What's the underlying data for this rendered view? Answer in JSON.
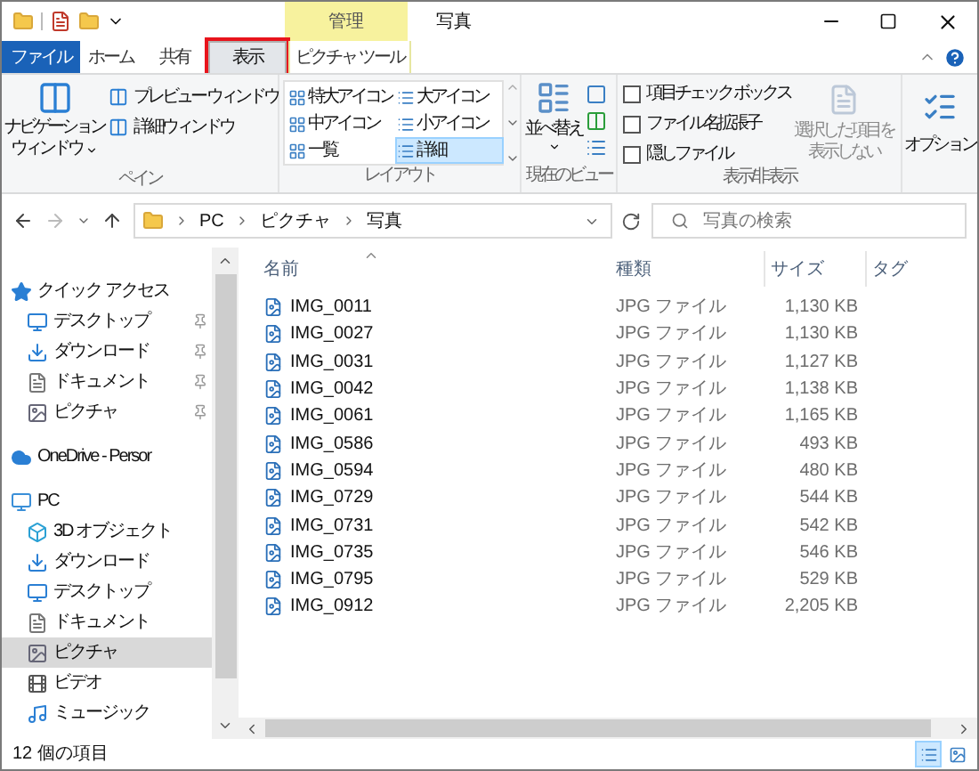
{
  "title_bar": {
    "title": "写真",
    "context_group": "管理"
  },
  "ribbon_tabs": [
    {
      "label": "ファイル",
      "kind": "file",
      "selected": false,
      "highlighted": false
    },
    {
      "label": "ホーム",
      "kind": "tab",
      "selected": false,
      "highlighted": false
    },
    {
      "label": "共有",
      "kind": "tab",
      "selected": false,
      "highlighted": false
    },
    {
      "label": "表示",
      "kind": "tab",
      "selected": true,
      "highlighted": true
    },
    {
      "label": "ピクチャ ツール",
      "kind": "context",
      "selected": false,
      "highlighted": false
    }
  ],
  "ribbon": {
    "pane": {
      "title": "ペイン",
      "nav_button": [
        "ナビゲーション",
        "ウィンドウ"
      ],
      "buttons": [
        "プレビュー ウィンドウ",
        "詳細ウィンドウ"
      ]
    },
    "layout": {
      "title": "レイアウト",
      "options": [
        {
          "label": "特大アイコン",
          "selected": false
        },
        {
          "label": "大アイコン",
          "selected": false
        },
        {
          "label": "中アイコン",
          "selected": false
        },
        {
          "label": "小アイコン",
          "selected": false
        },
        {
          "label": "一覧",
          "selected": false
        },
        {
          "label": "詳細",
          "selected": true
        }
      ]
    },
    "current_view": {
      "title": "現在のビュー",
      "sort_button": "並べ替え"
    },
    "show_hide": {
      "title": "表示/非表示",
      "checkboxes": [
        {
          "label": "項目チェック ボックス",
          "checked": false
        },
        {
          "label": "ファイル名拡張子",
          "checked": false
        },
        {
          "label": "隠しファイル",
          "checked": false
        }
      ],
      "hide_selected": {
        "lines": [
          "選択した項目を",
          "表示しない"
        ],
        "disabled": true
      }
    },
    "options": {
      "label": "オプション"
    }
  },
  "address_bar": {
    "path": [
      "PC",
      "ピクチャ",
      "写真"
    ],
    "search_placeholder": "写真の検索"
  },
  "navigation": [
    {
      "label": "クイック アクセス",
      "kind": "star",
      "selected": false,
      "children": [
        {
          "label": "デスクトップ",
          "kind": "desktop",
          "pinned": true,
          "selected": false
        },
        {
          "label": "ダウンロード",
          "kind": "download",
          "pinned": true,
          "selected": false
        },
        {
          "label": "ドキュメント",
          "kind": "document",
          "pinned": true,
          "selected": false
        },
        {
          "label": "ピクチャ",
          "kind": "picture",
          "pinned": true,
          "selected": false
        }
      ]
    },
    {
      "label": "OneDrive - Persor",
      "kind": "cloud",
      "selected": false
    },
    {
      "label": "PC",
      "kind": "pc",
      "selected": false,
      "children": [
        {
          "label": "3D オブジェクト",
          "kind": "cube",
          "pinned": false,
          "selected": false
        },
        {
          "label": "ダウンロード",
          "kind": "download",
          "pinned": false,
          "selected": false
        },
        {
          "label": "デスクトップ",
          "kind": "desktop",
          "pinned": false,
          "selected": false
        },
        {
          "label": "ドキュメント",
          "kind": "document",
          "pinned": false,
          "selected": false
        },
        {
          "label": "ピクチャ",
          "kind": "picture",
          "pinned": false,
          "selected": true
        },
        {
          "label": "ビデオ",
          "kind": "video",
          "pinned": false,
          "selected": false
        },
        {
          "label": "ミュージック",
          "kind": "music",
          "pinned": false,
          "selected": false
        }
      ]
    }
  ],
  "file_list": {
    "columns": [
      "名前",
      "種類",
      "サイズ",
      "タグ"
    ],
    "rows": [
      [
        "IMG_0011",
        "JPG ファイル",
        "1,130 KB"
      ],
      [
        "IMG_0027",
        "JPG ファイル",
        "1,130 KB"
      ],
      [
        "IMG_0031",
        "JPG ファイル",
        "1,127 KB"
      ],
      [
        "IMG_0042",
        "JPG ファイル",
        "1,138 KB"
      ],
      [
        "IMG_0061",
        "JPG ファイル",
        "1,165 KB"
      ],
      [
        "IMG_0586",
        "JPG ファイル",
        "493 KB"
      ],
      [
        "IMG_0594",
        "JPG ファイル",
        "480 KB"
      ],
      [
        "IMG_0729",
        "JPG ファイル",
        "544 KB"
      ],
      [
        "IMG_0731",
        "JPG ファイル",
        "542 KB"
      ],
      [
        "IMG_0735",
        "JPG ファイル",
        "546 KB"
      ],
      [
        "IMG_0795",
        "JPG ファイル",
        "529 KB"
      ],
      [
        "IMG_0912",
        "JPG ファイル",
        "2,205 KB"
      ]
    ]
  },
  "status_bar": {
    "item_count": "12 個の項目",
    "view_buttons": [
      {
        "kind": "details",
        "selected": true
      },
      {
        "kind": "large_icons",
        "selected": false
      }
    ]
  }
}
